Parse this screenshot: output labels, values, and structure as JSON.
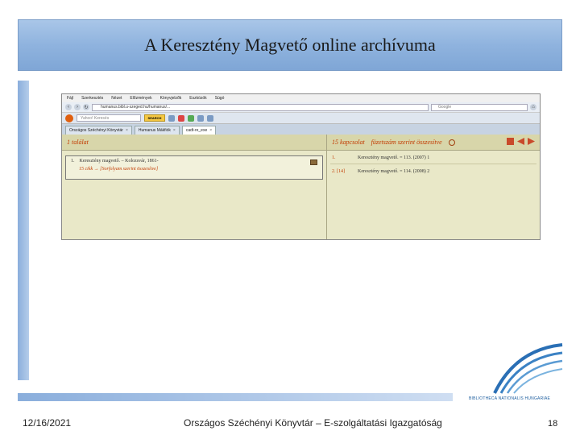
{
  "slide": {
    "title": "A Keresztény Magvető online archívuma",
    "footer_date": "12/16/2021",
    "footer_center": "Országos Széchényi Könyvtár – E-szolgáltatási Igazgatóság",
    "page_number": "18",
    "logo_text": "BIBLIOTHECA NATIONALIS HUNGARIAE"
  },
  "browser": {
    "menu": [
      "Fájl",
      "Szerkesztés",
      "Nézet",
      "Előzmények",
      "Könyvjelzők",
      "Eszközök",
      "Súgó"
    ],
    "url": "humanus.bibl.u-szeged.hu/humanus/...",
    "search_placeholder": "Google",
    "toolbar_search_placeholder": "Yahoo! Keresés",
    "toolbar_search_button": "SEARCH",
    "tabs": [
      {
        "label": "Országos Széchényi Könyvtár",
        "active": false
      },
      {
        "label": "Humanus Mákfiók",
        "active": false
      },
      {
        "label": "cadt-re_exe",
        "active": true
      }
    ]
  },
  "left_pane": {
    "header": "1 találat",
    "result_number": "1.",
    "result_text": "Keresztény magvető. – Kolozsvár, 1861-",
    "result_link": "15 cikk → [Sorfolyam szerint összesítve]"
  },
  "right_pane": {
    "header_count": "15 kapcsolat",
    "header_title": "füzetszám szerint összesítve",
    "items": [
      {
        "num": "1.",
        "text": "Keresztény magvető. = 113. (2007) 1"
      },
      {
        "num": "2. [14]",
        "text": "Keresztény magvető. = 114. (2008) 2"
      }
    ]
  }
}
